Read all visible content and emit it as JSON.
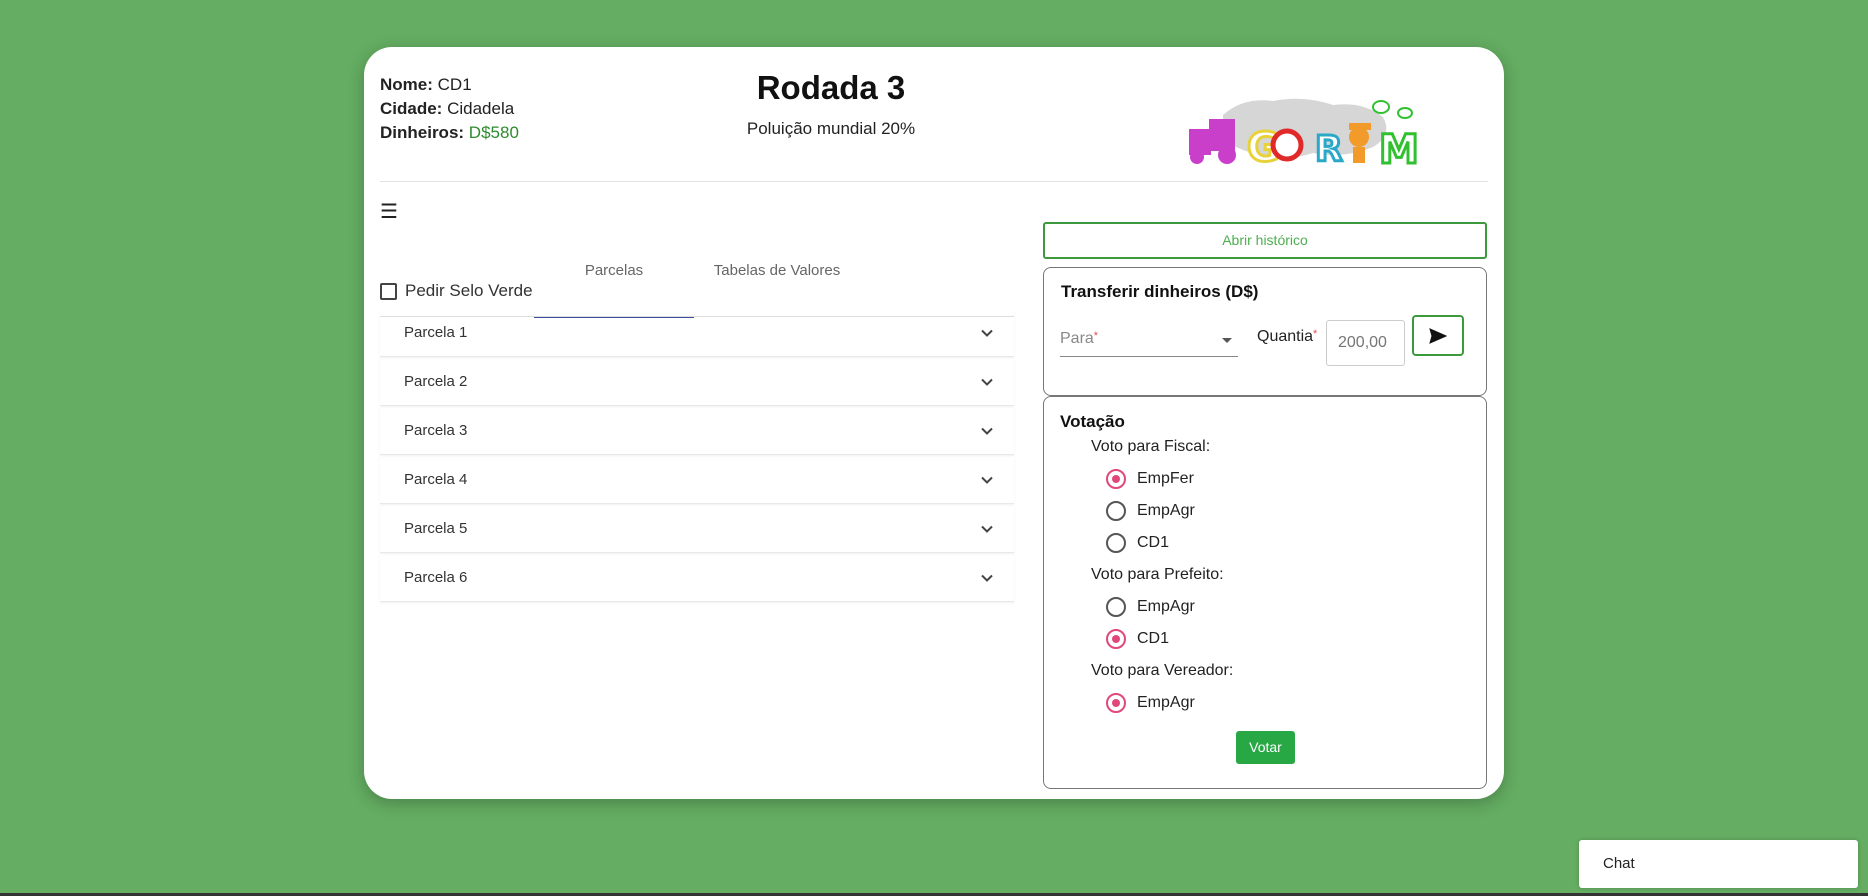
{
  "player": {
    "name_label": "Nome:",
    "name_value": "CD1",
    "city_label": "Cidade:",
    "city_value": "Cidadela",
    "money_label": "Dinheiros:",
    "money_value": "D$580"
  },
  "round": {
    "title": "Rodada 3",
    "pollution": "Poluição mundial 20%"
  },
  "logo": {
    "letters": "GORIM"
  },
  "tabs": [
    {
      "label": "Parcelas",
      "active": true
    },
    {
      "label": "Tabelas de Valores",
      "active": false
    }
  ],
  "selo_verde": {
    "label": "Pedir Selo Verde",
    "checked": false
  },
  "parcels": [
    {
      "label": "Parcela 1"
    },
    {
      "label": "Parcela 2"
    },
    {
      "label": "Parcela 3"
    },
    {
      "label": "Parcela 4"
    },
    {
      "label": "Parcela 5"
    },
    {
      "label": "Parcela 6"
    }
  ],
  "history_button": "Abrir histórico",
  "transfer": {
    "title": "Transferir dinheiros (D$)",
    "to_placeholder": "Para",
    "required_mark": "*",
    "amount_label": "Quantia",
    "amount_placeholder": "200,00"
  },
  "voting": {
    "title": "Votação",
    "groups": [
      {
        "label": "Voto para Fiscal:",
        "options": [
          {
            "label": "EmpFer",
            "selected": true
          },
          {
            "label": "EmpAgr",
            "selected": false
          },
          {
            "label": "CD1",
            "selected": false
          }
        ]
      },
      {
        "label": "Voto para Prefeito:",
        "options": [
          {
            "label": "EmpAgr",
            "selected": false
          },
          {
            "label": "CD1",
            "selected": true
          }
        ]
      },
      {
        "label": "Voto para Vereador:",
        "options": [
          {
            "label": "EmpAgr",
            "selected": true
          }
        ]
      }
    ],
    "submit_label": "Votar"
  },
  "chat": {
    "label": "Chat"
  },
  "colors": {
    "background": "#64ad62",
    "accent_green": "#28a745",
    "radio_pink": "#e0487c",
    "money_green": "#2e8b2e"
  }
}
